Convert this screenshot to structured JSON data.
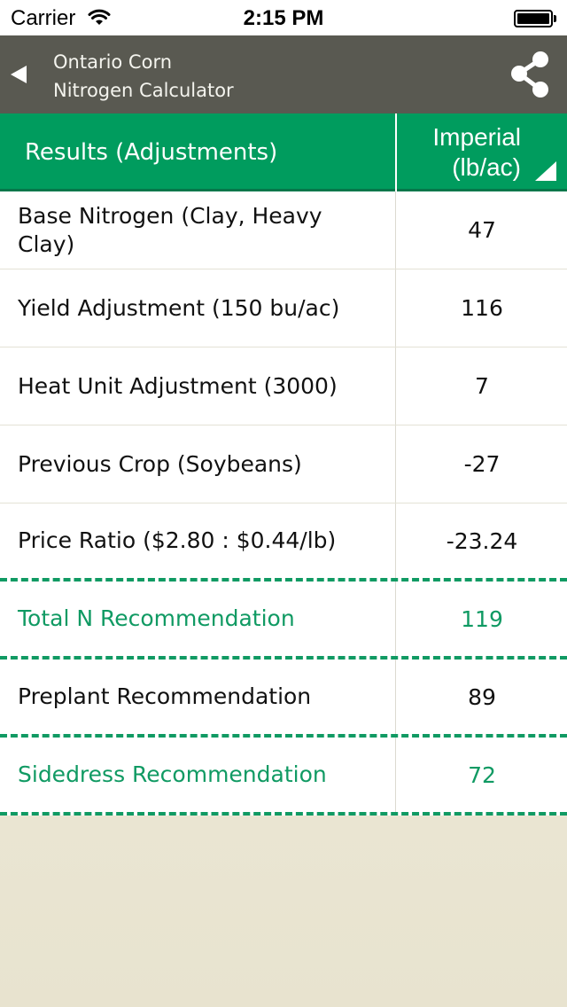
{
  "status_bar": {
    "carrier": "Carrier",
    "time": "2:15 PM"
  },
  "nav": {
    "title_line1": "Ontario Corn",
    "title_line2": "Nitrogen Calculator",
    "back_icon": "back-arrow-icon",
    "share_icon": "share-icon"
  },
  "header": {
    "label": "Results (Adjustments)",
    "unit_line1": "Imperial",
    "unit_line2": "(lb/ac)"
  },
  "rows": [
    {
      "label": "Base Nitrogen (Clay, Heavy Clay)",
      "value": "47"
    },
    {
      "label": "Yield Adjustment (150 bu/ac)",
      "value": "116"
    },
    {
      "label": "Heat Unit Adjustment (3000)",
      "value": "7"
    },
    {
      "label": "Previous Crop (Soybeans)",
      "value": "-27"
    },
    {
      "label": "Price Ratio ($2.80 : $0.44/lb)",
      "value": "-23.24"
    },
    {
      "label": "Total N Recommendation",
      "value": "119"
    },
    {
      "label": "Preplant Recommendation",
      "value": "89"
    },
    {
      "label": "Sidedress Recommendation",
      "value": "72"
    }
  ],
  "colors": {
    "nav_background": "#595951",
    "header_green": "#009c5e",
    "accent_green": "#109a63",
    "page_background": "#ebe7d4"
  }
}
